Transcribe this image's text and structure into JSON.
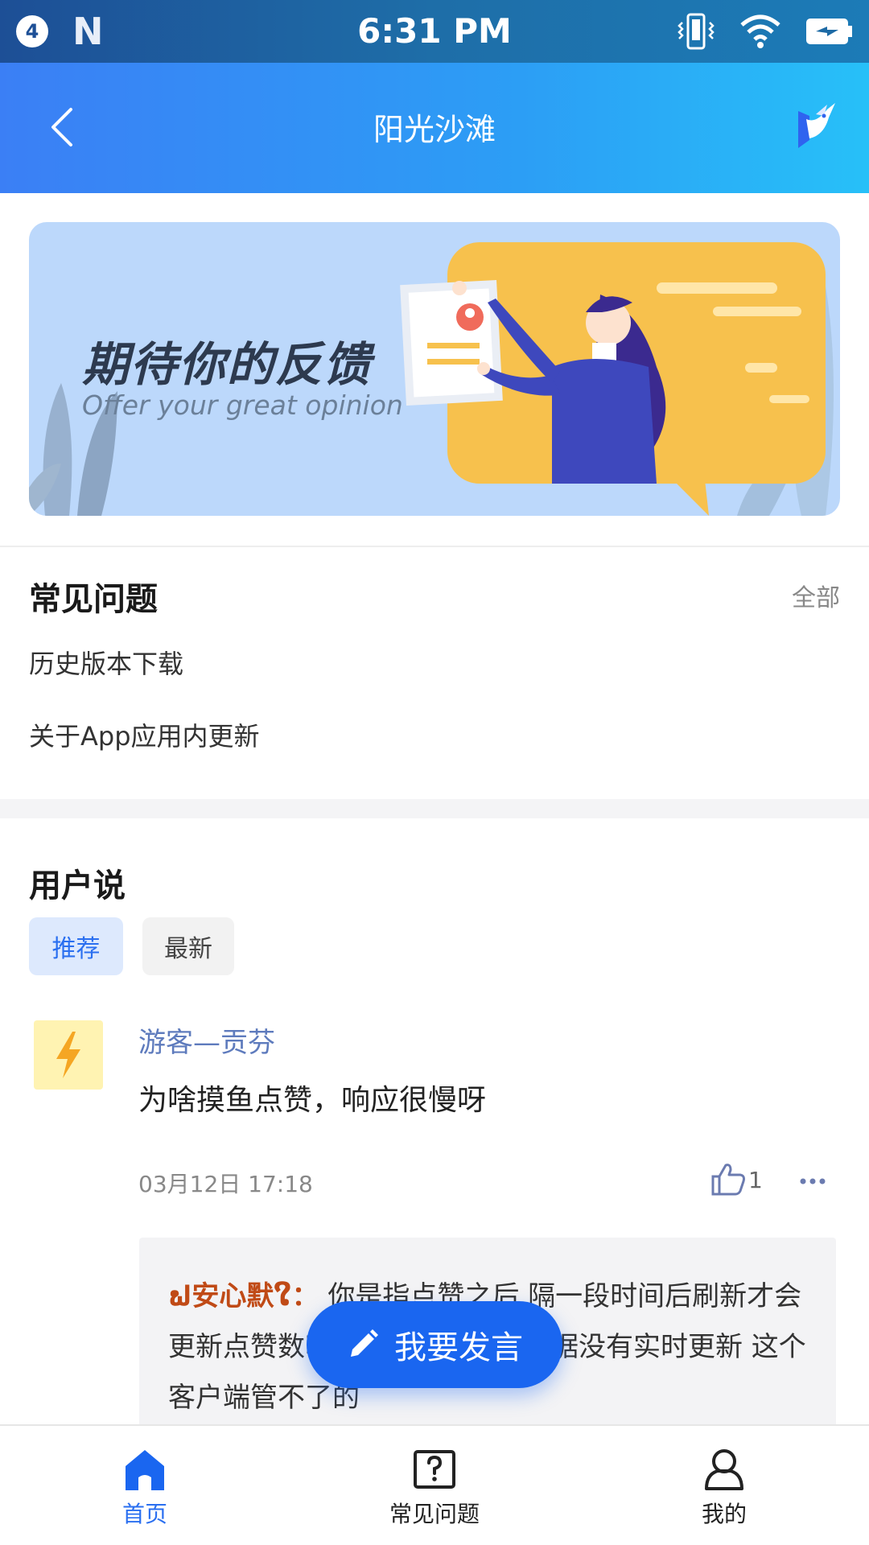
{
  "status_bar": {
    "notification_count": "4",
    "n_logo": "N",
    "time": "6:31 PM"
  },
  "app_bar": {
    "title": "阳光沙滩"
  },
  "banner": {
    "title": "期待你的反馈",
    "subtitle": "Offer your great opinion"
  },
  "faq": {
    "title": "常见问题",
    "all_label": "全部",
    "items": [
      "历史版本下载",
      "关于App应用内更新"
    ]
  },
  "user_say": {
    "title": "用户说",
    "tabs": [
      "推荐",
      "最新"
    ],
    "post": {
      "author": "游客—贡芬",
      "text": "为啥摸鱼点赞，响应很慢呀",
      "time": "03月12日 17:18",
      "likes": "1",
      "reply": {
        "author": "ຟ安心默ໃ：",
        "text": "你是指点赞之后 隔一段时间后刷新才会更新点赞数吗？这个是接口的数据没有实时更新 这个客户端管不了的"
      }
    }
  },
  "fab": {
    "label": "我要发言"
  },
  "bottom_nav": {
    "items": [
      "首页",
      "常见问题",
      "我的"
    ],
    "active": "首页"
  },
  "colors": {
    "accent": "#1a66f0",
    "appbar_start": "#3b7ff5",
    "appbar_end": "#27c0f8",
    "author": "#5e7bbd",
    "reply_author": "#c04a16"
  }
}
